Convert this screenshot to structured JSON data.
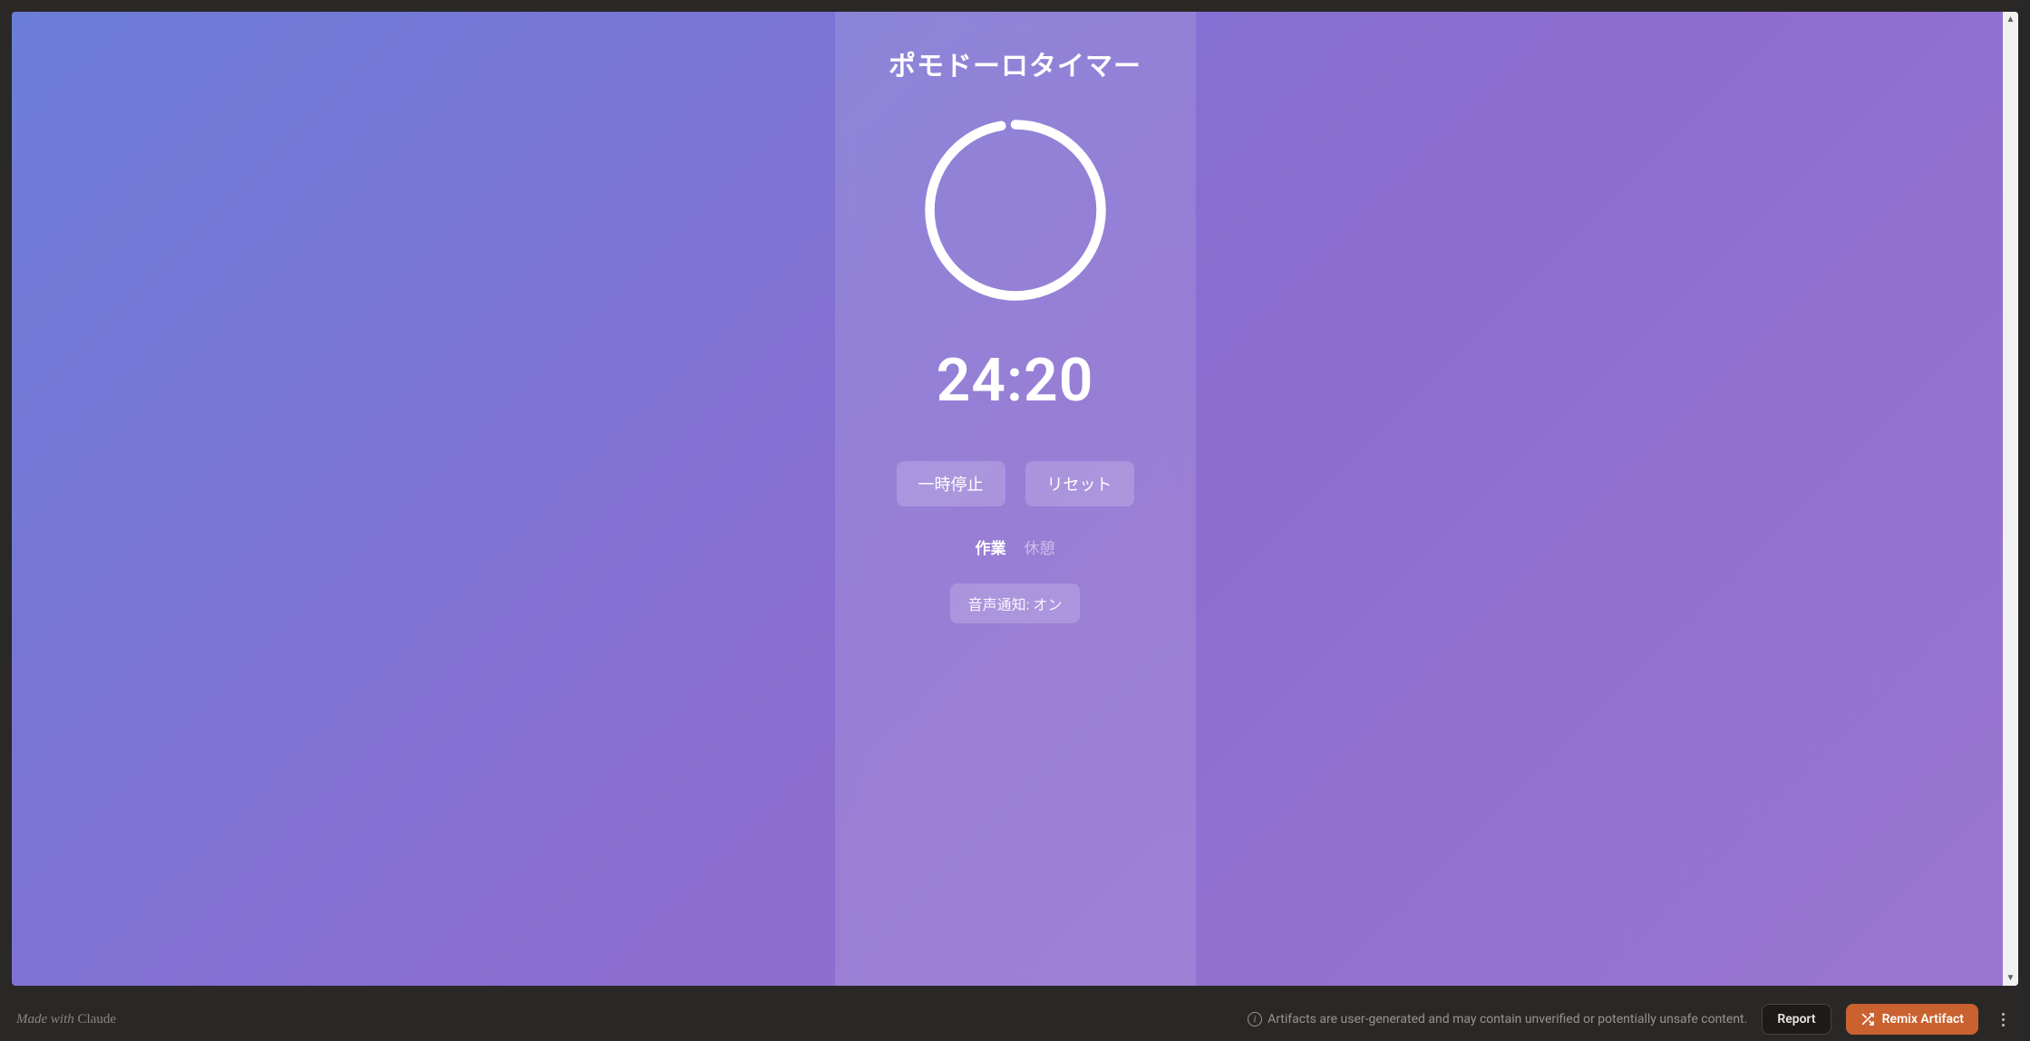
{
  "timer": {
    "title": "ポモドーロタイマー",
    "time_display": "24:20",
    "progress_fraction": 0.973,
    "buttons": {
      "pause_label": "一時停止",
      "reset_label": "リセット"
    },
    "modes": {
      "work_label": "作業",
      "break_label": "休憩",
      "active": "work"
    },
    "sound_toggle_label": "音声通知: オン"
  },
  "footer": {
    "made_with_prefix": "Made with ",
    "made_with_brand": "Claude",
    "warning_text": "Artifacts are user-generated and may contain unverified or potentially unsafe content.",
    "report_label": "Report",
    "remix_label": "Remix Artifact"
  }
}
